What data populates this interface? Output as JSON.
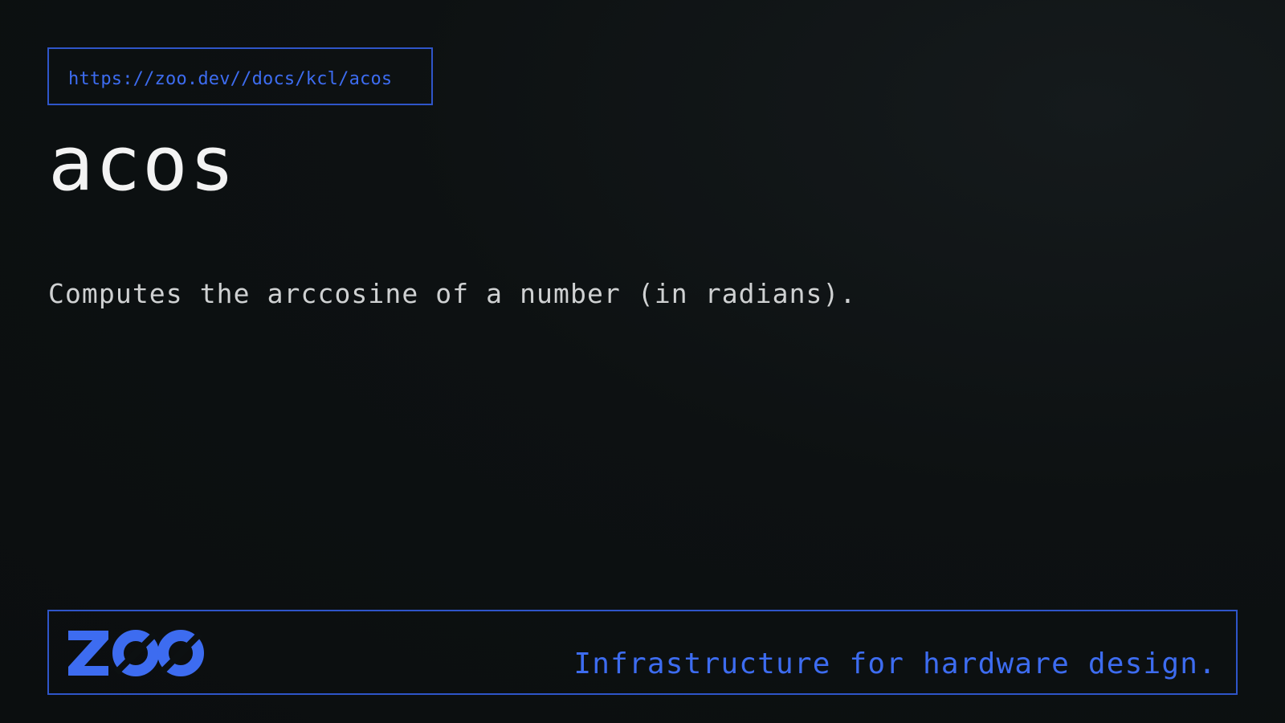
{
  "header": {
    "url": "https://zoo.dev//docs/kcl/acos"
  },
  "main": {
    "title": "acos",
    "description": "Computes the arccosine of a number (in radians)."
  },
  "footer": {
    "logo_icon": "zoo-logo",
    "tagline": "Infrastructure for hardware design."
  },
  "colors": {
    "background": "#0b0e0f",
    "accent": "#3d6cf0",
    "border": "#2f55c9",
    "title": "#f3f3f3",
    "body_text": "#cfd1d2"
  }
}
